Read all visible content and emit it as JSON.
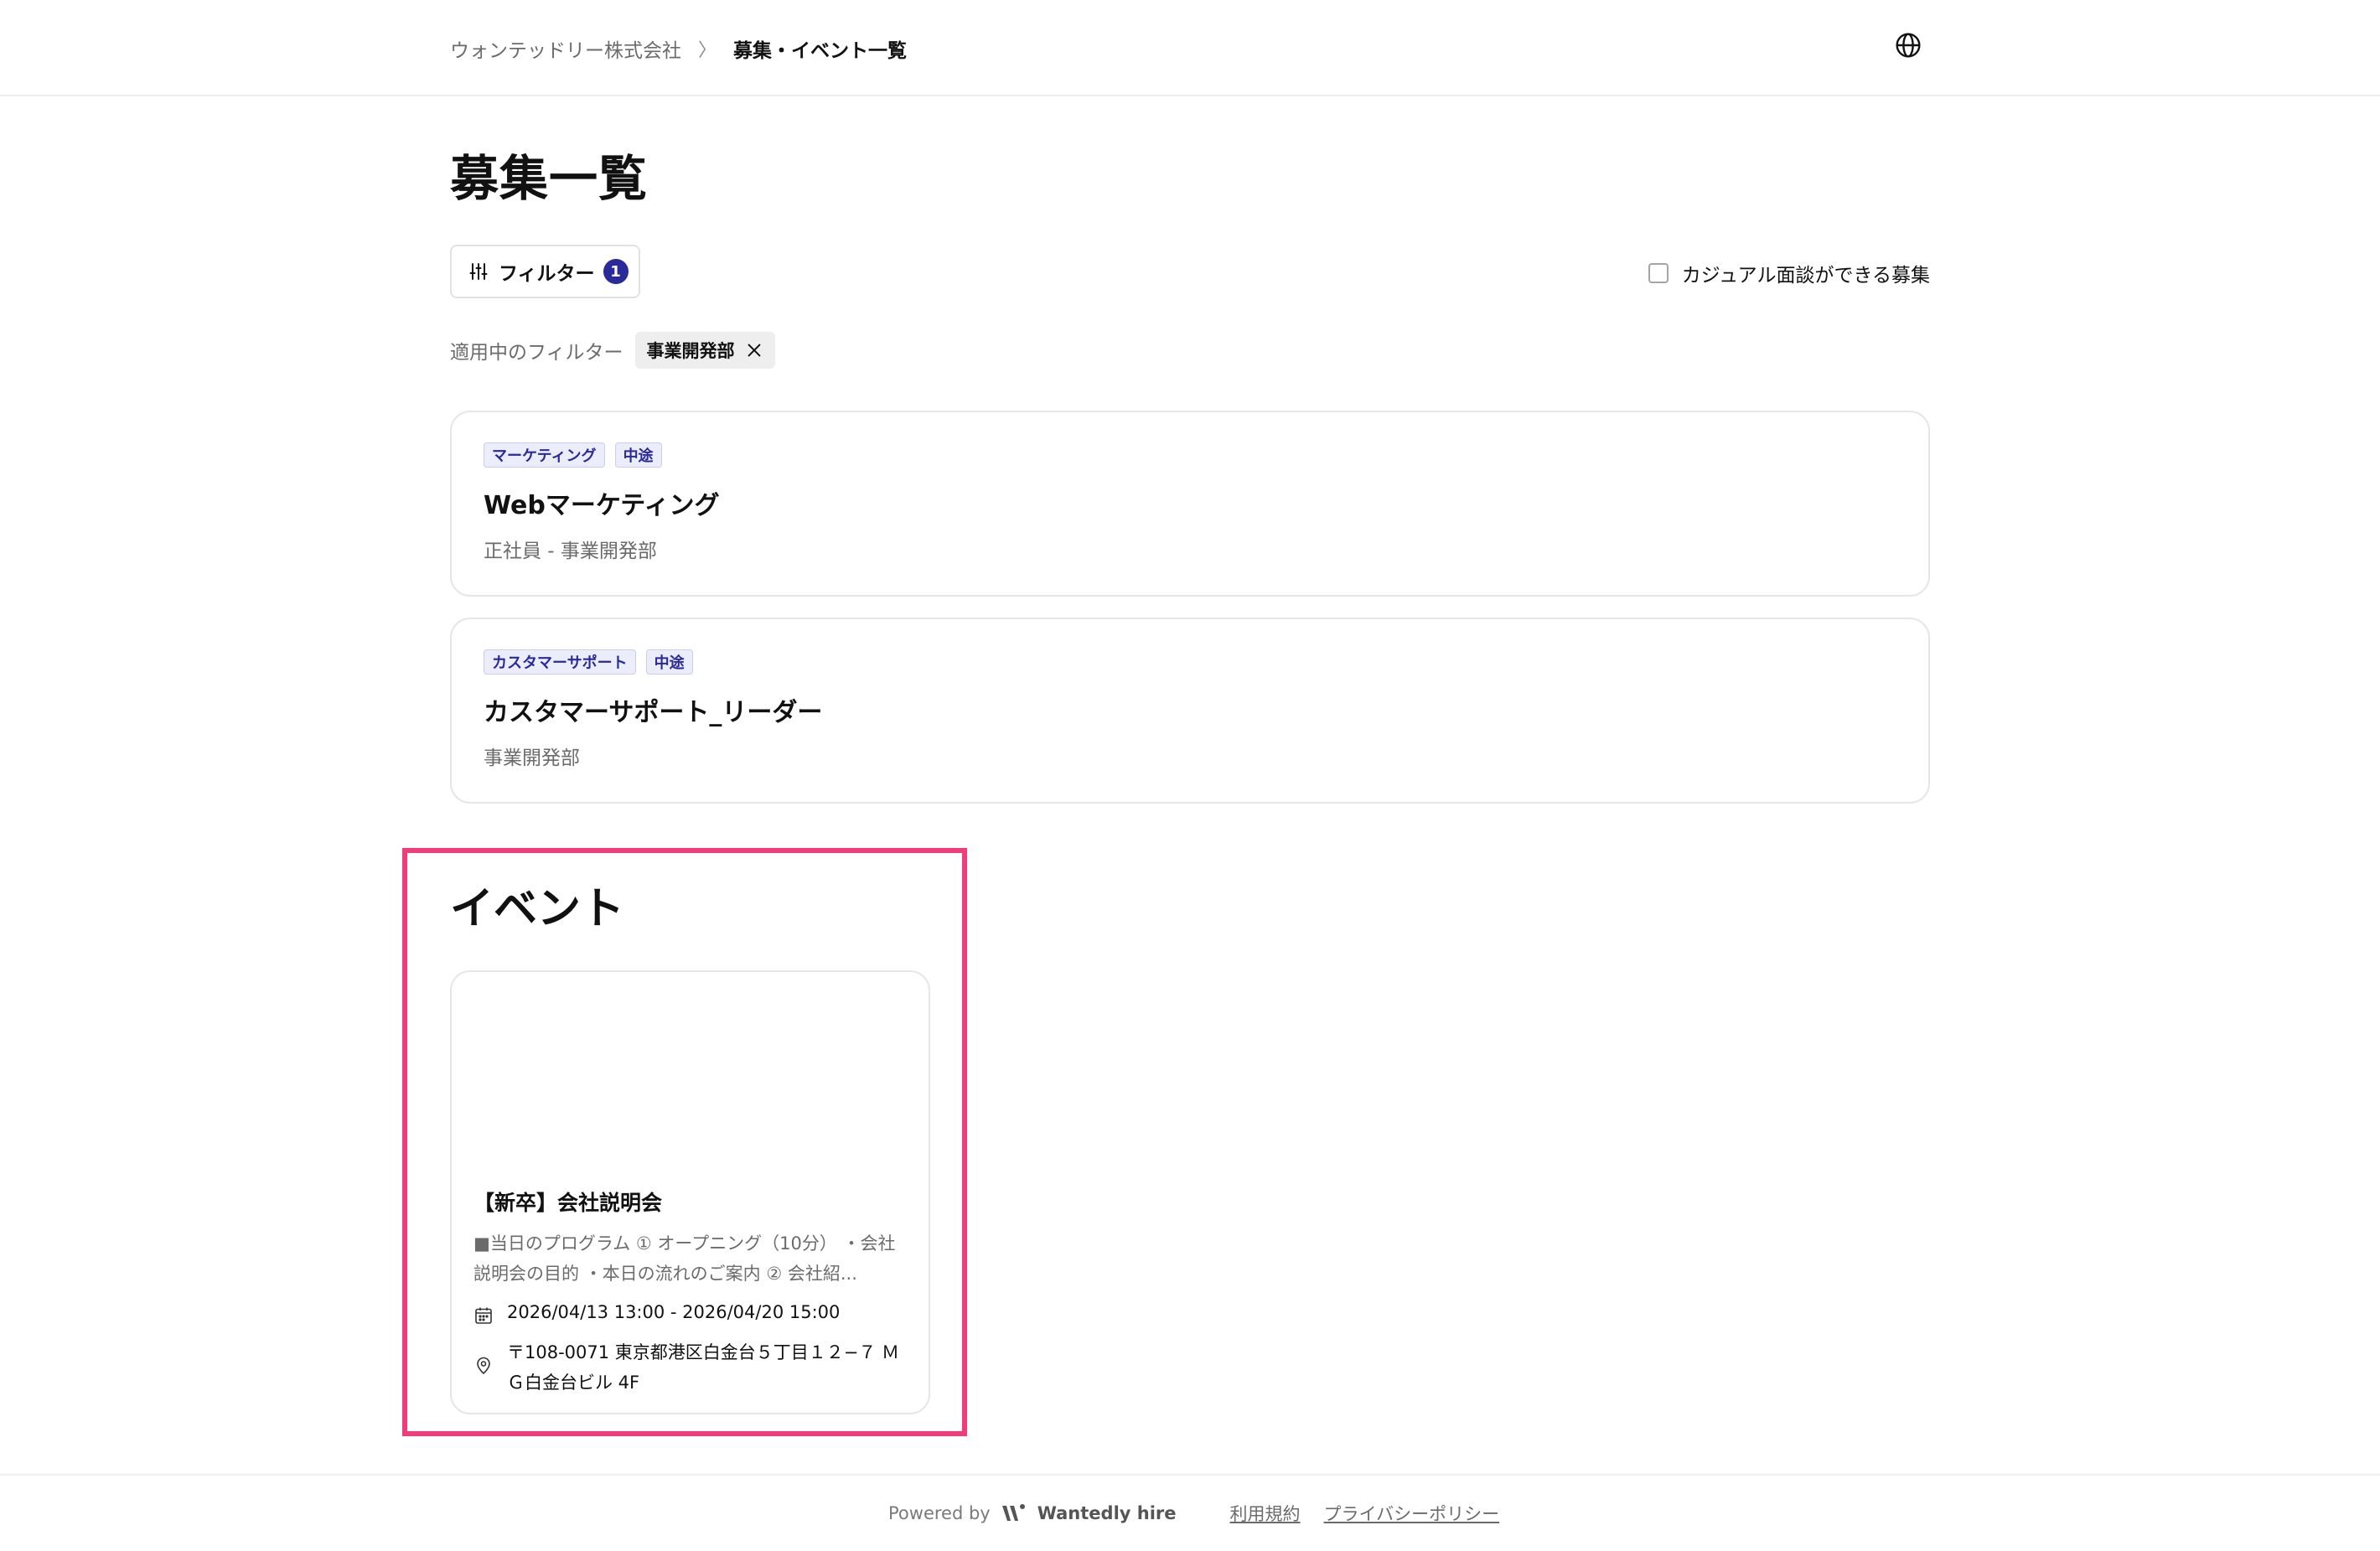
{
  "header": {
    "breadcrumb_company": "ウォンテッドリー株式会社",
    "breadcrumb_separator": "〉",
    "breadcrumb_current": "募集・イベント一覧",
    "language_icon": "globe-icon"
  },
  "main": {
    "title": "募集一覧",
    "filter_button_label": "フィルター",
    "filter_count": "1",
    "casual_interview_label": "カジュアル面談ができる募集",
    "casual_interview_checked": false,
    "applied_filters_label": "適用中のフィルター",
    "applied_filter_chip": "事業開発部"
  },
  "jobs": [
    {
      "tags": [
        "マーケティング",
        "中途"
      ],
      "title": "Webマーケティング",
      "subtitle": "正社員 - 事業開発部"
    },
    {
      "tags": [
        "カスタマーサポート",
        "中途"
      ],
      "title": "カスタマーサポート_リーダー",
      "subtitle": "事業開発部"
    }
  ],
  "events": {
    "heading": "イベント",
    "items": [
      {
        "title": "【新卒】会社説明会",
        "description": "■当日のプログラム ① オープニング（10分） ・会社説明会の目的 ・本日の流れのご案内 ② 会社紹...",
        "datetime": "2026/04/13 13:00 - 2026/04/20 15:00",
        "location": "〒108-0071 東京都港区白金台５丁目１２−７ ＭＧ白金台ビル 4F"
      }
    ]
  },
  "footer": {
    "powered_by": "Powered by",
    "brand": "Wantedly hire",
    "terms": "利用規約",
    "privacy": "プライバシーポリシー"
  },
  "colors": {
    "accent": "#2a2a9b",
    "tag_bg": "#ebedfa",
    "highlight_border": "#f03c78",
    "muted_text": "#6b6b6b"
  }
}
